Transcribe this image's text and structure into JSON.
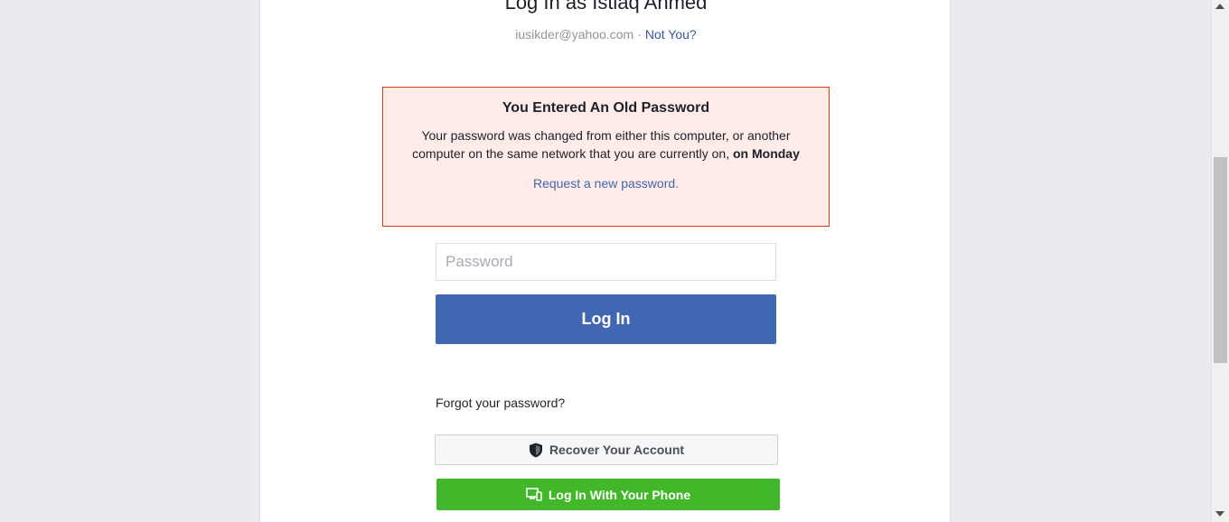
{
  "header": {
    "title": "Log In as Istiaq Ahmed",
    "email": "iusikder@yahoo.com",
    "separator": "·",
    "not_you": "Not You?"
  },
  "alert": {
    "title": "You Entered An Old Password",
    "body": "Your password was changed from either this computer, or another computer on the same network that you are currently on,",
    "body_bold": "on Monday",
    "link": "Request a new password."
  },
  "form": {
    "password_placeholder": "Password",
    "login_label": "Log In",
    "forgot_label": "Forgot your password?",
    "recover_label": "Recover Your Account",
    "phone_label": "Log In With Your Phone"
  },
  "icons": {
    "shield": "shield-icon",
    "device": "device-icon"
  },
  "colors": {
    "brand_blue": "#4267b2",
    "link_blue": "#365899",
    "alert_bg": "#ffebe8",
    "alert_border": "#dd3c10",
    "green": "#42b72a"
  }
}
